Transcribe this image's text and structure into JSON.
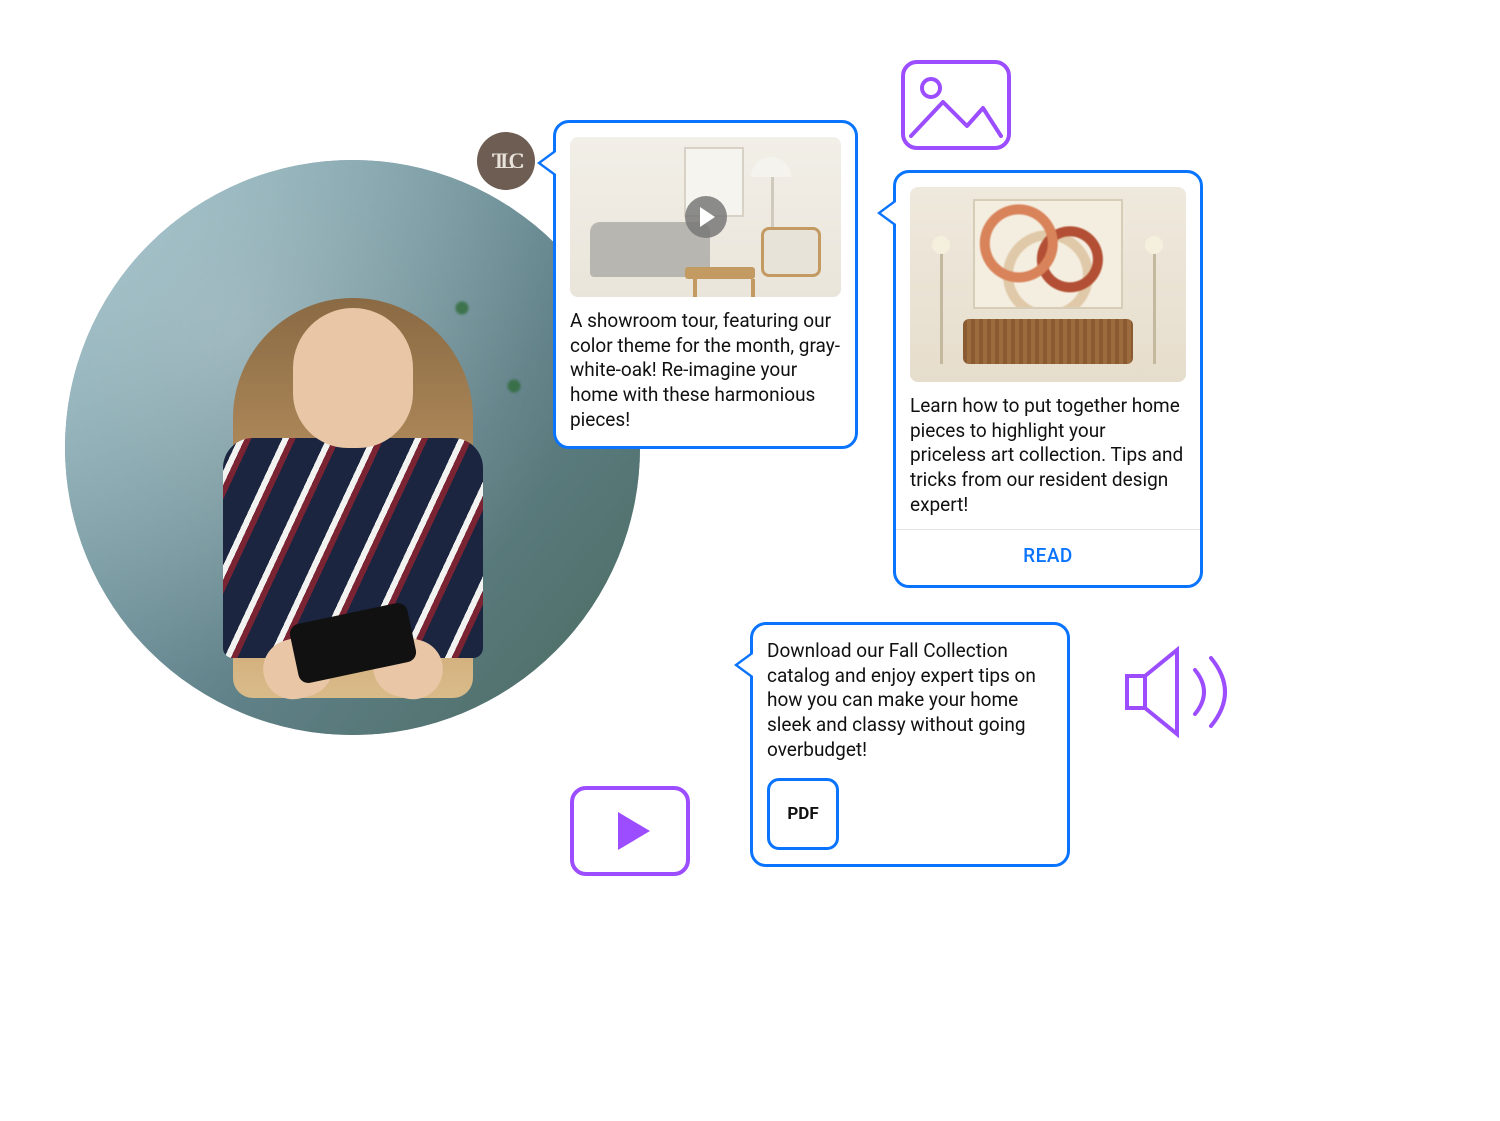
{
  "avatar_label": "TLC",
  "bubble1": {
    "text": "A showroom tour, featuring our color theme for the month, gray-white-oak! Re-imagine your home with these harmonious pieces!"
  },
  "bubble2": {
    "text": "Learn how to put together home pieces to highlight your priceless art collection. Tips and tricks from our resident design expert!",
    "action_label": "READ"
  },
  "bubble3": {
    "text": "Download our Fall Collection catalog and enjoy expert tips on how you can make your home sleek and classy without going overbudget!",
    "file_label": "PDF"
  },
  "colors": {
    "bubble_border": "#0a74ff",
    "accent_purple": "#9b4dff"
  }
}
